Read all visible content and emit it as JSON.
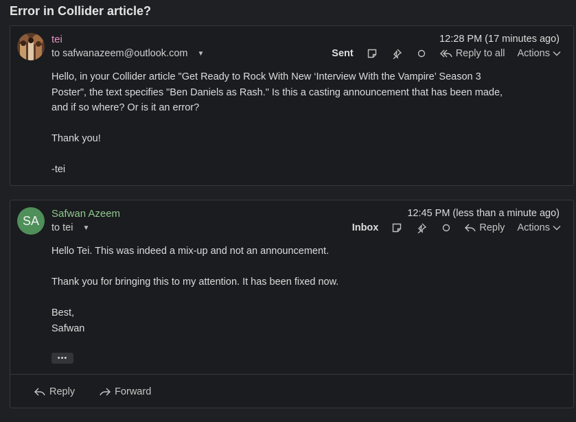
{
  "thread": {
    "subject": "Error in Collider article?"
  },
  "messages": [
    {
      "sender": "tei",
      "recipient": "to safwanazeem@outlook.com",
      "timestamp": "12:28 PM (17 minutes ago)",
      "folder": "Sent",
      "reply_label": "Reply to all",
      "actions_label": "Actions",
      "body": [
        "Hello, in your Collider article \"Get Ready to Rock With New ‘Interview With the Vampire’ Season 3",
        "Poster\", the text specifies \"Ben Daniels as Rash.\" Is this a casting announcement that has been made,",
        "and if so where? Or is it an error?",
        "",
        "Thank you!",
        "",
        "-tei"
      ]
    },
    {
      "sender": "Safwan Azeem",
      "avatar_initials": "SA",
      "recipient": "to tei",
      "timestamp": "12:45 PM (less than a minute ago)",
      "folder": "Inbox",
      "reply_label": "Reply",
      "actions_label": "Actions",
      "body": [
        "Hello Tei. This was indeed a mix-up and not an announcement.",
        "",
        "Thank you for bringing this to my attention. It has been fixed now.",
        "",
        "Best,",
        "Safwan"
      ],
      "ellipsis": "•••"
    }
  ],
  "footer": {
    "reply_label": "Reply",
    "forward_label": "Forward"
  },
  "colors": {
    "background": "#1f2023",
    "card": "#1b1c1f",
    "sender_tei": "#e394c6",
    "sender_safwan": "#8fc98f",
    "avatar_green": "#4f8f5a"
  }
}
